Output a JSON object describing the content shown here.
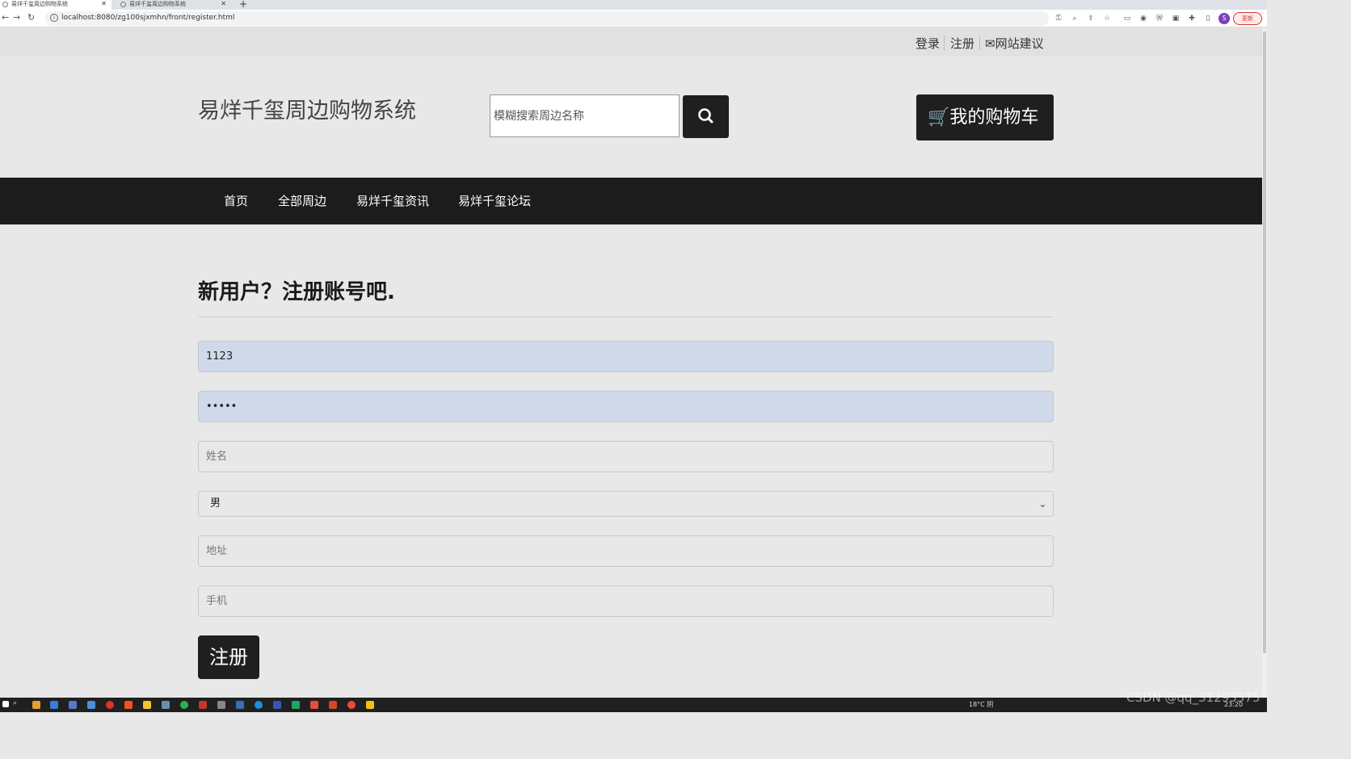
{
  "browser": {
    "tabs": [
      {
        "title": "易烊千玺周边购物系统"
      },
      {
        "title": "易烊千玺周边购物系统"
      }
    ],
    "url": "localhost:8080/zg100sjxmhn/front/register.html",
    "update_label": "更新",
    "profile_initial": "S"
  },
  "topbar": {
    "login": "登录",
    "register": "注册",
    "feedback": "网站建议"
  },
  "header": {
    "site_title": "易烊千玺周边购物系统",
    "search_placeholder": "模糊搜索周边名称",
    "cart_label": "我的购物车"
  },
  "nav": {
    "items": [
      {
        "label": "首页"
      },
      {
        "label": "全部周边"
      },
      {
        "label": "易烊千玺资讯"
      },
      {
        "label": "易烊千玺论坛"
      }
    ]
  },
  "form": {
    "title": "新用户？注册账号吧.",
    "username_value": "1123",
    "password_value": "•••••",
    "name_placeholder": "姓名",
    "gender_value": "男",
    "address_placeholder": "地址",
    "phone_placeholder": "手机",
    "submit_label": "注册"
  },
  "taskbar": {
    "weather": "18°C 阴",
    "time": "23:20"
  },
  "watermark": "CSDN @qq_31293575"
}
